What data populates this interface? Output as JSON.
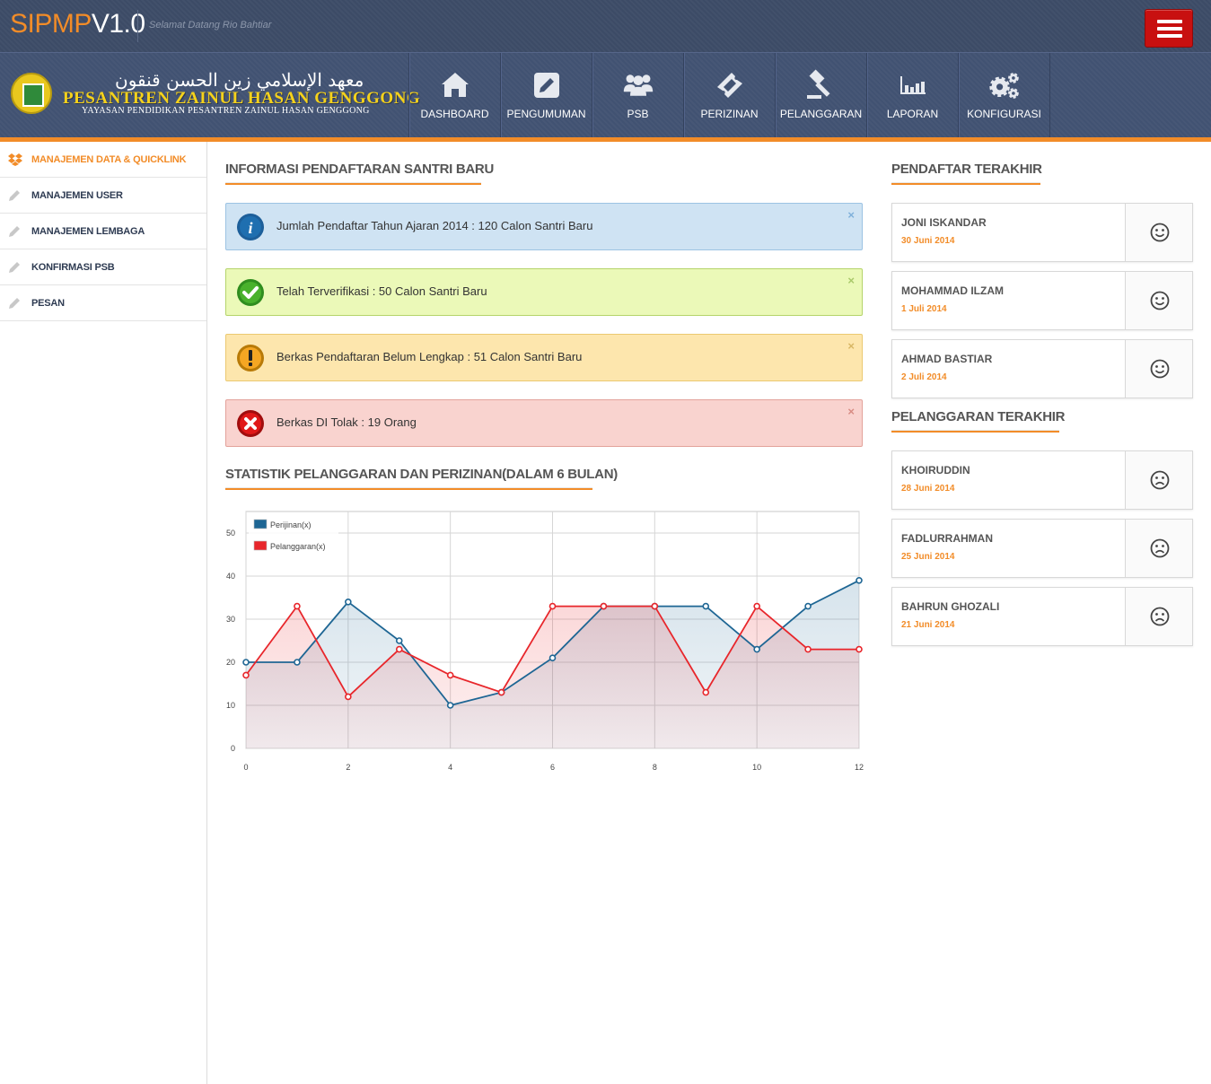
{
  "app": {
    "brand_part1": "SIPMP",
    "brand_part2": "V1.0",
    "welcome": "Selamat Datang Rio Bahtiar"
  },
  "logo": {
    "arabic": "معهد الإسلامي زين الحسن قنقون",
    "title": "PESANTREN ZAINUL HASAN GENGGONG",
    "subtitle": "YAYASAN PENDIDIKAN PESANTREN ZAINUL HASAN GENGGONG"
  },
  "nav": [
    {
      "label": "DASHBOARD",
      "icon": "home-icon"
    },
    {
      "label": "PENGUMUMAN",
      "icon": "edit-icon"
    },
    {
      "label": "PSB",
      "icon": "users-icon"
    },
    {
      "label": "PERIZINAN",
      "icon": "ticket-icon"
    },
    {
      "label": "PELANGGARAN",
      "icon": "gavel-icon"
    },
    {
      "label": "LAPORAN",
      "icon": "bar-chart-icon"
    },
    {
      "label": "KONFIGURASI",
      "icon": "gears-icon"
    }
  ],
  "sidebar": [
    {
      "label": "MANAJEMEN DATA & QUICKLINK",
      "icon": "dropbox-icon",
      "active": true
    },
    {
      "label": "MANAJEMEN USER",
      "icon": "pencil-icon"
    },
    {
      "label": "MANAJEMEN LEMBAGA",
      "icon": "pencil-icon"
    },
    {
      "label": "KONFIRMASI PSB",
      "icon": "pencil-icon"
    },
    {
      "label": "PESAN",
      "icon": "pencil-icon"
    }
  ],
  "info_section": {
    "title": "INFORMASI PENDAFTARAN SANTRI BARU",
    "alerts": [
      {
        "type": "info",
        "icon": "info-icon",
        "text": "Jumlah Pendaftar Tahun Ajaran 2014 : 120 Calon Santri Baru",
        "close": "×"
      },
      {
        "type": "success",
        "icon": "check-icon",
        "text": "Telah Terverifikasi : 50 Calon Santri Baru",
        "close": "×"
      },
      {
        "type": "warning",
        "icon": "exclamation-icon",
        "text": "Berkas Pendaftaran Belum Lengkap : 51 Calon Santri Baru",
        "close": "×"
      },
      {
        "type": "error",
        "icon": "x-icon",
        "text": "Berkas DI Tolak : 19 Orang",
        "close": "×"
      }
    ]
  },
  "stats_section": {
    "title": "STATISTIK PELANGGARAN DAN PERIZINAN(DALAM 6 BULAN)"
  },
  "chart_data": {
    "type": "area",
    "x": [
      0,
      1,
      2,
      3,
      4,
      5,
      6,
      7,
      8,
      9,
      10,
      11,
      12
    ],
    "series": [
      {
        "name": "Perijinan(x)",
        "color": "#1e6694",
        "values": [
          20,
          20,
          34,
          25,
          10,
          13,
          21,
          33,
          33,
          33,
          23,
          33,
          39
        ]
      },
      {
        "name": "Pelanggaran(x)",
        "color": "#e8262b",
        "values": [
          17,
          33,
          12,
          23,
          17,
          13,
          33,
          33,
          33,
          13,
          33,
          23,
          23
        ]
      }
    ],
    "xlim": [
      0,
      12
    ],
    "ylim": [
      0,
      55
    ],
    "xticks": [
      "0",
      "2",
      "4",
      "6",
      "8",
      "10",
      "12"
    ],
    "yticks": [
      "0",
      "10",
      "20",
      "30",
      "40",
      "50"
    ],
    "grid": true,
    "legend": "top-left"
  },
  "recent_registrants": {
    "title": "PENDAFTAR TERAKHIR",
    "items": [
      {
        "name": "JONI ISKANDAR",
        "date": "30 Juni 2014",
        "icon": "smile-icon"
      },
      {
        "name": "MOHAMMAD ILZAM",
        "date": "1 Juli 2014",
        "icon": "smile-icon"
      },
      {
        "name": "AHMAD BASTIAR",
        "date": "2 Juli 2014",
        "icon": "smile-icon"
      }
    ]
  },
  "recent_violations": {
    "title": "PELANGGARAN TERAKHIR",
    "items": [
      {
        "name": "KHOIRUDDIN",
        "date": "28 Juni 2014",
        "icon": "frown-icon"
      },
      {
        "name": "FADLURRAHMAN",
        "date": "25 Juni 2014",
        "icon": "frown-icon"
      },
      {
        "name": "BAHRUN GHOZALI",
        "date": "21 Juni 2014",
        "icon": "frown-icon"
      }
    ]
  }
}
